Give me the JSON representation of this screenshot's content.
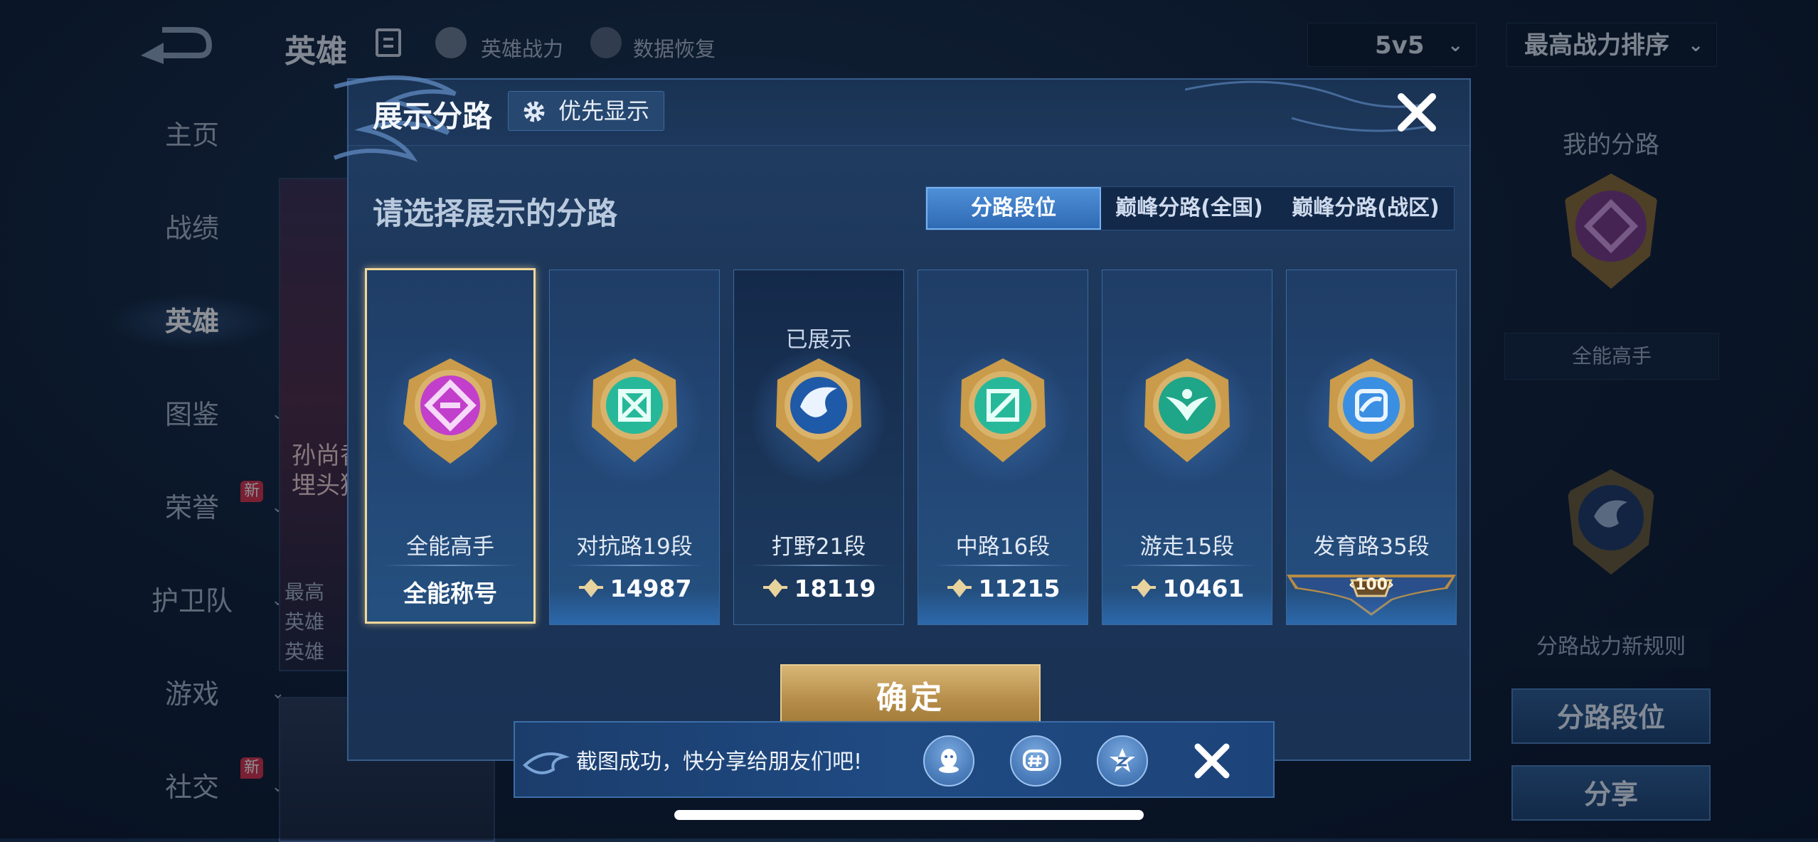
{
  "background": {
    "title": "英雄",
    "top_links": [
      "英雄战力",
      "数据恢复"
    ],
    "mode_select": "5v5",
    "sort_select": "最高战力排序",
    "nav": [
      {
        "label": "主页",
        "badge": ""
      },
      {
        "label": "战绩",
        "badge": ""
      },
      {
        "label": "英雄",
        "badge": ""
      },
      {
        "label": "图鉴",
        "badge": ""
      },
      {
        "label": "荣誉",
        "badge": "新"
      },
      {
        "label": "护卫队",
        "badge": ""
      },
      {
        "label": "游戏",
        "badge": ""
      },
      {
        "label": "社交",
        "badge": "新"
      }
    ],
    "hero_name_partial": [
      "孙尚香",
      "埋头猛"
    ],
    "hero_info_partial": [
      "最高",
      "英雄",
      "英雄"
    ],
    "right_panel": {
      "title": "我的分路",
      "emblem_label": "全能高手",
      "rules_link": "分路战力新规则",
      "buttons": [
        "分路段位",
        "分享"
      ]
    }
  },
  "modal": {
    "title": "展示分路",
    "priority_button": "优先显示",
    "subtitle": "请选择展示的分路",
    "tabs": [
      "分路段位",
      "巅峰分路(全国)",
      "巅峰分路(战区)"
    ],
    "active_tab": 0,
    "cards": [
      {
        "lane": "全能高手",
        "value": "全能称号",
        "shown": "",
        "selected": true,
        "emblem": "all-round-emblem",
        "color": "#c53bd0"
      },
      {
        "lane": "对抗路19段",
        "value": "14987",
        "shown": "",
        "selected": false,
        "emblem": "clash-lane-emblem",
        "color": "#27b89a"
      },
      {
        "lane": "打野21段",
        "value": "18119",
        "shown": "已展示",
        "selected": false,
        "emblem": "jungle-emblem",
        "color": "#2f6fc2"
      },
      {
        "lane": "中路16段",
        "value": "11215",
        "shown": "",
        "selected": false,
        "emblem": "mid-lane-emblem",
        "color": "#27b89a"
      },
      {
        "lane": "游走15段",
        "value": "10461",
        "shown": "",
        "selected": false,
        "emblem": "roam-emblem",
        "color": "#22a88c"
      },
      {
        "lane": "发育路35段",
        "value": "100",
        "shown": "",
        "selected": false,
        "emblem": "farm-lane-emblem",
        "color": "#3c8fe0"
      }
    ],
    "confirm": "确定"
  },
  "toast": {
    "text": "截图成功，快分享给朋友们吧!",
    "icons": [
      "qq-icon",
      "wechat-moments-icon",
      "qzone-icon"
    ]
  }
}
